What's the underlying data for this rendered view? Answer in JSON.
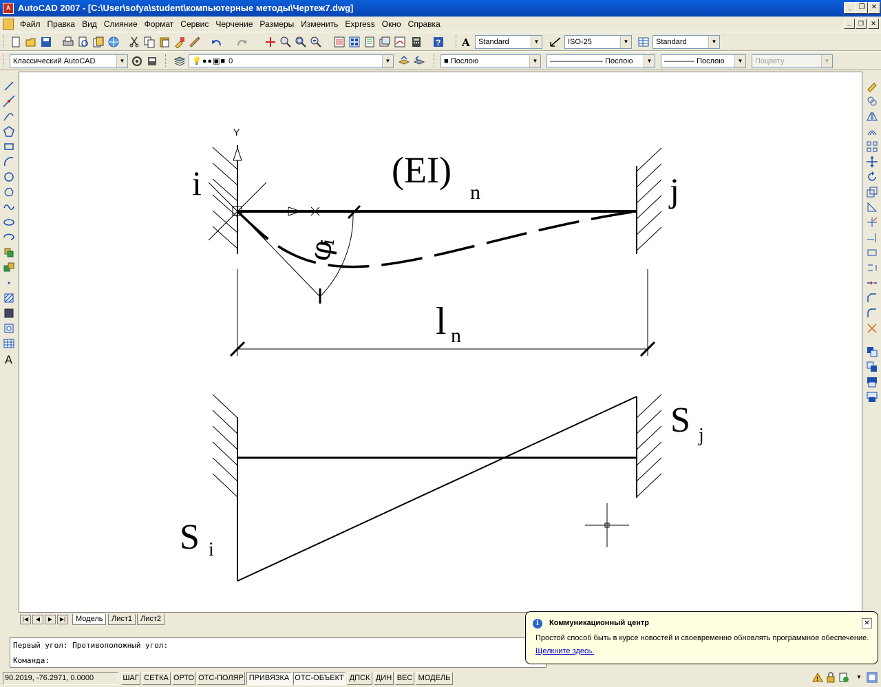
{
  "window": {
    "app_icon_label": "A",
    "title": "AutoCAD 2007 - [C:\\User\\sofya\\student\\компьютерные методы\\Чертеж7.dwg]",
    "min": "_",
    "max": "❐",
    "close": "✕"
  },
  "menu": {
    "items": [
      "Файл",
      "Правка",
      "Вид",
      "Слияние",
      "Формат",
      "Сервис",
      "Черчение",
      "Размеры",
      "Изменить",
      "Express",
      "Окно",
      "Справка"
    ]
  },
  "toolbar_styles": {
    "text_style": "Standard",
    "dim_style": "ISO-25",
    "table_style": "Standard"
  },
  "toolbar_layers": {
    "workspace": "Классический AutoCAD",
    "layer": "0",
    "color": "Послою",
    "linetype": "Послою",
    "lineweight": "Послою",
    "plotstyle": "Поцвету"
  },
  "drawing": {
    "axis_y": "Y",
    "label_i": "i",
    "label_j": "j",
    "label_EI": "(EI)",
    "label_EI_sub": "n",
    "label_phi": "φ",
    "label_phi_sub": "i",
    "label_l": "l",
    "label_l_sub": "n",
    "label_Si": "S",
    "label_Si_sub": "i",
    "label_Sj": "S",
    "label_Sj_sub": "j"
  },
  "tabs": {
    "nav": [
      "|◀",
      "◀",
      "▶",
      "▶|"
    ],
    "items": [
      "Модель",
      "Лист1",
      "Лист2"
    ]
  },
  "command": {
    "line1": "Первый угол: Противоположный угол:",
    "line2": "Команда:"
  },
  "status": {
    "coords": "90.2019, -76.2971, 0.0000",
    "buttons": [
      "ШАГ",
      "СЕТКА",
      "ОРТО",
      "ОТС-ПОЛЯР",
      "ПРИВЯЗКА",
      "ОТС-ОБЪЕКТ",
      "ДПСК",
      "ДИН",
      "ВЕС",
      "МОДЕЛЬ"
    ]
  },
  "balloon": {
    "title": "Коммуникационный центр",
    "text": "Простой способ быть в курсе новостей и своевременно обновлять программное обеспечение.",
    "link": "Щелкните здесь.",
    "info_icon": "i",
    "close": "✕"
  }
}
